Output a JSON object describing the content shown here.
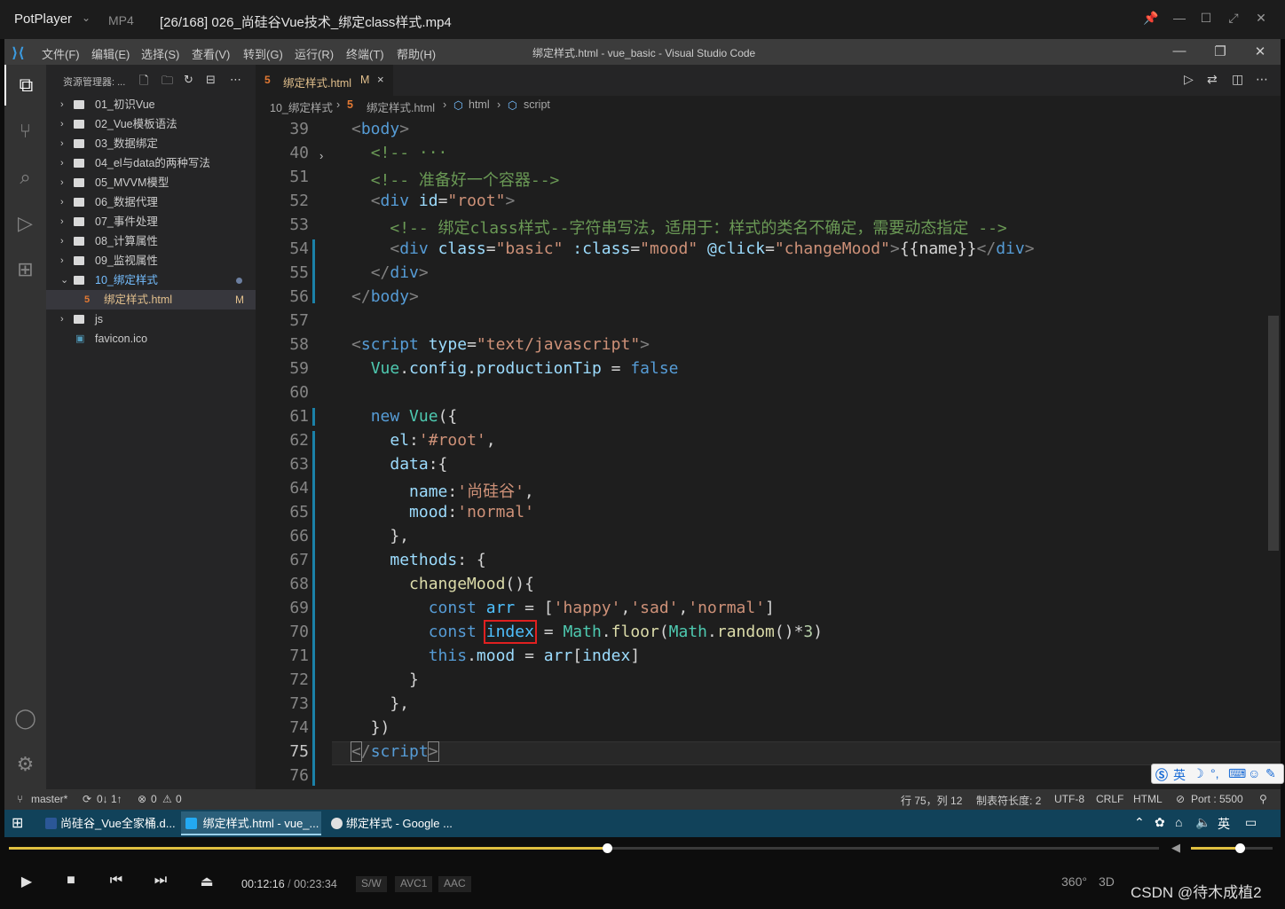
{
  "player": {
    "brand": "PotPlayer",
    "chevron": "⌄",
    "format": "MP4",
    "file_title": "[26/168] 026_尚硅谷Vue技术_绑定class样式.mp4",
    "window_buttons": [
      "pin-icon",
      "minimize-icon",
      "maximize-icon",
      "fullscreen-icon",
      "close-icon"
    ],
    "time_current": "00:12:16",
    "time_sep": "/",
    "time_total": "00:23:34",
    "pills": [
      "S/W",
      "AVC1",
      "AAC"
    ],
    "right_icons": [
      "360°",
      "3D"
    ],
    "watermark": "CSDN @待木成植2",
    "progress": 0.52,
    "volume": 0.6,
    "accent": "#e0c040"
  },
  "vscode": {
    "window_title": "绑定样式.html - vue_basic - Visual Studio Code",
    "menu": [
      "文件(F)",
      "编辑(E)",
      "选择(S)",
      "查看(V)",
      "转到(G)",
      "运行(R)",
      "终端(T)",
      "帮助(H)"
    ],
    "explorer": {
      "title": "资源管理器: ...",
      "items": [
        {
          "label": "01_初识Vue",
          "type": "folder",
          "expanded": false
        },
        {
          "label": "02_Vue模板语法",
          "type": "folder",
          "expanded": false
        },
        {
          "label": "03_数据绑定",
          "type": "folder",
          "expanded": false
        },
        {
          "label": "04_el与data的两种写法",
          "type": "folder",
          "expanded": false
        },
        {
          "label": "05_MVVM模型",
          "type": "folder",
          "expanded": false
        },
        {
          "label": "06_数据代理",
          "type": "folder",
          "expanded": false
        },
        {
          "label": "07_事件处理",
          "type": "folder",
          "expanded": false
        },
        {
          "label": "08_计算属性",
          "type": "folder",
          "expanded": false
        },
        {
          "label": "09_监视属性",
          "type": "folder",
          "expanded": false
        },
        {
          "label": "10_绑定样式",
          "type": "folder",
          "expanded": true
        },
        {
          "label": "绑定样式.html",
          "type": "file",
          "badge": "M"
        },
        {
          "label": "js",
          "type": "folder",
          "expanded": false
        },
        {
          "label": "favicon.ico",
          "type": "file"
        }
      ]
    },
    "tab": {
      "label": "绑定样式.html",
      "badge": "M",
      "close": "×"
    },
    "breadcrumb": [
      "10_绑定样式",
      "绑定样式.html",
      "html",
      "script"
    ],
    "line_numbers": [
      "39",
      "40",
      "51",
      "52",
      "53",
      "54",
      "55",
      "56",
      "57",
      "58",
      "59",
      "60",
      "61",
      "62",
      "63",
      "64",
      "65",
      "66",
      "67",
      "68",
      "69",
      "70",
      "71",
      "72",
      "73",
      "74",
      "75",
      "76"
    ],
    "status": {
      "branch": "master*",
      "sync": "0↓ 1↑",
      "problems": "0",
      "warnings": "0",
      "position": "行 75，列 12",
      "tab_size": "制表符长度: 2",
      "encoding": "UTF-8",
      "eol": "CRLF",
      "language": "HTML",
      "port": "Port : 5500"
    },
    "ime_label": "英"
  },
  "taskbar": {
    "items": [
      {
        "label": "尚硅谷_Vue全家桶.d...",
        "color": "#2b5797"
      },
      {
        "label": "绑定样式.html - vue_...",
        "color": "#23a9f2"
      },
      {
        "label": "绑定样式 - Google ...",
        "color": "#e0e0e0"
      }
    ],
    "tray_lang": "英"
  }
}
